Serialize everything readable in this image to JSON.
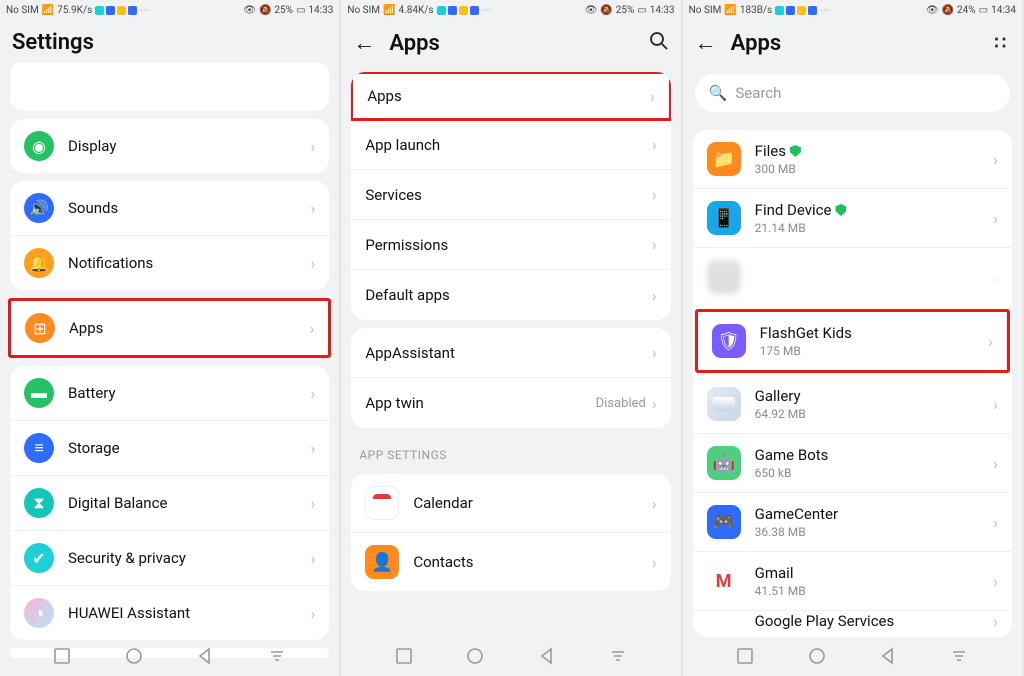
{
  "screens": {
    "a": {
      "status": {
        "sim": "No SIM",
        "speed": "75.9K/s",
        "battery": "25%",
        "time": "14:33"
      },
      "title": "Settings",
      "rows1": [
        {
          "label": "Display",
          "color": "#25c265",
          "iconName": "eye-icon"
        }
      ],
      "rows2": [
        {
          "label": "Sounds",
          "color": "#2f6bff",
          "iconName": "volume-icon"
        },
        {
          "label": "Notifications",
          "color": "#ff9f1e",
          "iconName": "bell-icon"
        }
      ],
      "apps_label": "Apps",
      "rows3": [
        {
          "label": "Battery",
          "color": "#25c265",
          "iconName": "battery-icon"
        },
        {
          "label": "Storage",
          "color": "#2f6bff",
          "iconName": "storage-icon"
        },
        {
          "label": "Digital Balance",
          "color": "#12c7b7",
          "iconName": "hourglass-icon"
        },
        {
          "label": "Security & privacy",
          "color": "#1ed0d6",
          "iconName": "shield-icon"
        },
        {
          "label": "HUAWEI Assistant",
          "color": "linear-gradient(135deg,#f8b3d9,#b3e4f8)",
          "iconName": "assistant-icon"
        }
      ]
    },
    "b": {
      "status": {
        "sim": "No SIM",
        "speed": "4.84K/s",
        "battery": "25%",
        "time": "14:33"
      },
      "title": "Apps",
      "apps_label": "Apps",
      "menu1": [
        {
          "label": "App launch"
        },
        {
          "label": "Services"
        },
        {
          "label": "Permissions"
        },
        {
          "label": "Default apps"
        }
      ],
      "menu2": [
        {
          "label": "AppAssistant"
        },
        {
          "label": "App twin",
          "value": "Disabled"
        }
      ],
      "section": "APP SETTINGS",
      "menu3": [
        {
          "label": "Calendar",
          "color": "#fff",
          "border": "1px solid #eee",
          "inner": "#e43b3b",
          "iconName": "calendar-icon"
        },
        {
          "label": "Contacts",
          "color": "#ff8a1e",
          "iconName": "contacts-icon"
        }
      ]
    },
    "c": {
      "status": {
        "sim": "No SIM",
        "speed": "183B/s",
        "battery": "24%",
        "time": "14:34"
      },
      "title": "Apps",
      "search_placeholder": "Search",
      "apps": [
        {
          "name": "Files",
          "size": "300 MB",
          "color": "#ff8a1e",
          "shield": true,
          "iconName": "files-app-icon"
        },
        {
          "name": "Find Device",
          "size": "21.14 MB",
          "color": "#1aa7ea",
          "shield": true,
          "iconName": "find-device-app-icon"
        },
        {
          "name": "",
          "size": "",
          "color": "#d8d8d8",
          "blurred": true,
          "iconName": "blurred-app-icon"
        },
        {
          "name": "FlashGet Kids",
          "size": "175 MB",
          "color": "#7d5cff",
          "highlight": true,
          "iconName": "flashget-kids-app-icon"
        },
        {
          "name": "Gallery",
          "size": "64.92 MB",
          "color": "linear-gradient(135deg,#e3ecf5,#c8d6e8)",
          "iconName": "gallery-app-icon"
        },
        {
          "name": "Game Bots",
          "size": "650 kB",
          "color": "#4cd080",
          "iconName": "game-bots-app-icon"
        },
        {
          "name": "GameCenter",
          "size": "36.38 MB",
          "color": "#2f6bff",
          "iconName": "gamecenter-app-icon"
        },
        {
          "name": "Gmail",
          "size": "41.51 MB",
          "color": "#ffffff",
          "iconName": "gmail-app-icon",
          "gmail": true
        },
        {
          "name": "Google Play Services",
          "size": "",
          "color": "#ffffff",
          "iconName": "google-play-services-icon",
          "partial": true
        }
      ]
    }
  }
}
